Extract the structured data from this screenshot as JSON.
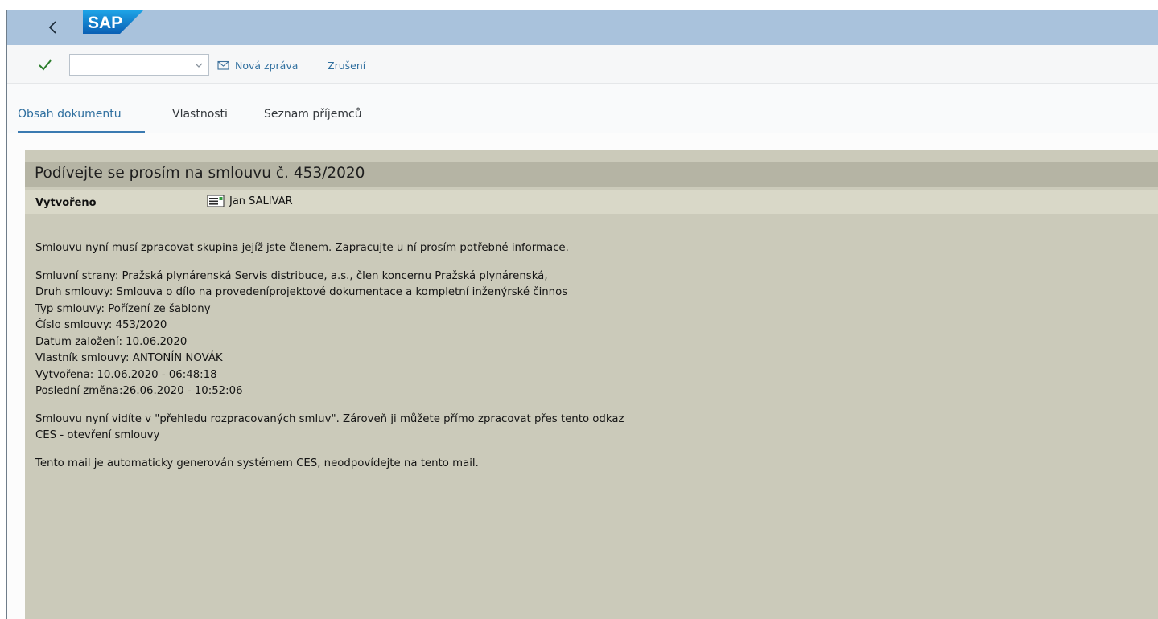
{
  "header": {
    "back_icon": "chevron-left-icon",
    "logo_text": "SAP",
    "logo_color": "#0a6ed1"
  },
  "toolbar": {
    "check_icon": "checkmark-icon",
    "command_field": {
      "value": "",
      "placeholder": ""
    },
    "new_message_label": "Nová zpráva",
    "new_message_icon": "envelope-icon",
    "cancel_label": "Zrušení"
  },
  "tabs": [
    {
      "label": "Obsah dokumentu",
      "active": true
    },
    {
      "label": "Vlastnosti",
      "active": false
    },
    {
      "label": "Seznam příjemců",
      "active": false
    }
  ],
  "document": {
    "title": "Podívejte se prosím na smlouvu č. 453/2020",
    "created_label": "Vytvořeno",
    "created_by": "Jan SALIVAR",
    "created_by_icon": "business-card-icon",
    "intro": "Smlouvu nyní musí zpracovat skupina jejíž jste členem. Zapracujte u ní prosím potřebné informace.",
    "details": [
      "Smluvní strany: Pražská plynárenská Servis distribuce, a.s., člen koncernu Pražská plynárenská,",
      "Druh smlouvy: Smlouva o dílo na provedeníprojektové dokumentace a kompletní inženýrské činnos",
      "Typ smlouvy: Pořízení ze šablony",
      "Číslo smlouvy: 453/2020",
      "Datum založení: 10.06.2020",
      "Vlastník smlouvy: ANTONÍN NOVÁK",
      "Vytvořena: 10.06.2020 - 06:48:18",
      "Poslední změna:26.06.2020 - 10:52:06"
    ],
    "overview_note": "Smlouvu nyní vidíte v \"přehledu rozpracovaných smluv\". Zároveň ji můžete přímo zpracovat přes tento odkaz",
    "link_text": "CES - otevření smlouvy",
    "footer_note": "Tento mail je automaticky generován systémem CES, neodpovídejte na tento mail."
  },
  "colors": {
    "shell_header": "#a9c2dc",
    "doc_background": "#cbcaba",
    "accent": "#2f6f9f",
    "check_green": "#2b7d2b"
  }
}
